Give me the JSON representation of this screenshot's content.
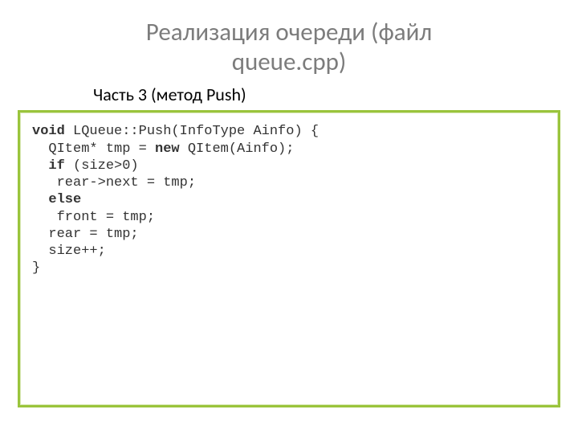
{
  "title_line1": "Реализация очереди (файл",
  "title_line2": "queue.cpp)",
  "subtitle": "Часть 3 (метод Push)",
  "code": {
    "l1a": "void",
    "l1b": " LQueue::Push(InfoType Ainfo) {",
    "l2a": "  QItem* tmp = ",
    "l2b": "new",
    "l2c": " QItem(Ainfo);",
    "l3a": "  ",
    "l3b": "if",
    "l3c": " (size>0)",
    "l4": "   rear->next = tmp;",
    "l5a": "  ",
    "l5b": "else",
    "l6": "   front = tmp;",
    "l7": "  rear = tmp;",
    "l8": "  size++;",
    "l9": "}"
  }
}
